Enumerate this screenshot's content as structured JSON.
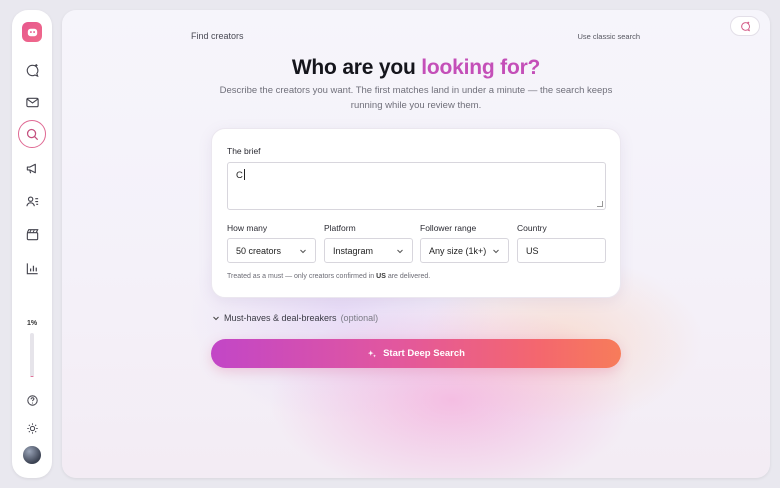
{
  "sidebar": {
    "items": [
      {
        "icon": "chat-sparkle-icon"
      },
      {
        "icon": "mail-icon"
      },
      {
        "icon": "search-icon",
        "active": true
      },
      {
        "icon": "megaphone-icon"
      },
      {
        "icon": "contacts-icon"
      },
      {
        "icon": "clapperboard-icon"
      },
      {
        "icon": "bar-chart-icon"
      }
    ],
    "usage_label": "1%",
    "usage_fraction": 0.01,
    "help_icon": "help-icon",
    "theme_icon": "sun-icon"
  },
  "header": {
    "breadcrumb": "Find creators",
    "classic_link": "Use classic search",
    "corner_icon": "chat-sparkle-icon"
  },
  "hero": {
    "title_plain": "Who are you ",
    "title_accent": "looking for?",
    "subtitle": "Describe the creators you want. The first matches land in under a minute — the search keeps running while you review them."
  },
  "form": {
    "brief_label": "The brief",
    "brief_value": "C",
    "how_many_label": "How many",
    "how_many_value": "50 creators",
    "platform_label": "Platform",
    "platform_value": "Instagram",
    "follower_label": "Follower range",
    "follower_value": "Any size (1k+)",
    "country_label": "Country",
    "country_value": "US",
    "note_prefix": "Treated as a must — only creators confirmed in ",
    "note_country": "US",
    "note_suffix": " are delivered."
  },
  "musthaves": {
    "label": "Must-haves & deal-breakers",
    "optional": "(optional)"
  },
  "cta": {
    "label": "Start Deep Search"
  },
  "colors": {
    "accent": "#c44fb8",
    "cta_start": "#c246c7",
    "cta_end": "#f77c5a"
  }
}
